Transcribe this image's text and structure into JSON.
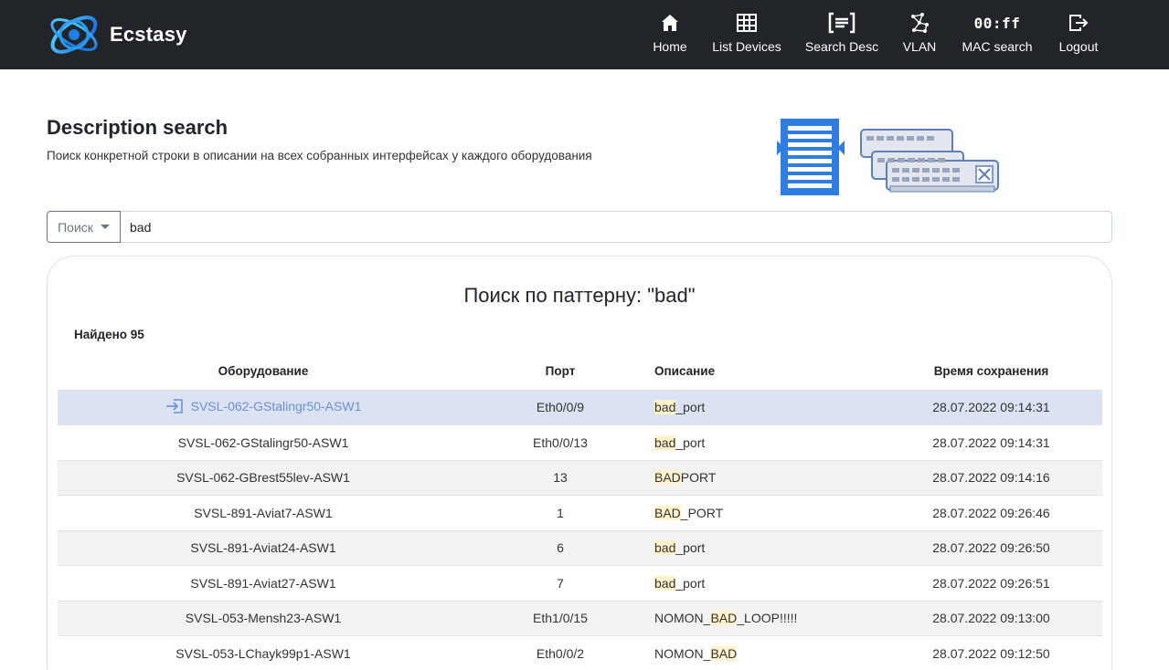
{
  "brand": {
    "name": "Ecstasy"
  },
  "nav": [
    {
      "label": "Home",
      "icon": "home-icon"
    },
    {
      "label": "List Devices",
      "icon": "table-icon"
    },
    {
      "label": "Search Desc",
      "icon": "text-box-icon"
    },
    {
      "label": "VLAN",
      "icon": "network-icon"
    },
    {
      "label": "MAC search",
      "icon": "mac-icon",
      "icon_text": "00:ff"
    },
    {
      "label": "Logout",
      "icon": "logout-icon"
    }
  ],
  "header": {
    "title": "Description search",
    "subtitle": "Поиск конкретной строки в описании на всех собранных интерфейсах у каждого оборудования"
  },
  "search": {
    "select_label": "Поиск",
    "value": "bad"
  },
  "results": {
    "title": "Поиск по паттерну: \"bad\"",
    "found": "Найдено 95",
    "columns": [
      "Оборудование",
      "Порт",
      "Описание",
      "Время сохранения"
    ],
    "rows": [
      {
        "device": "SVSL-062-GStalingr50-ASW1",
        "port": "Eth0/0/9",
        "desc_match": "bad",
        "desc_rest": "_port",
        "desc_prefix": "",
        "time": "28.07.2022 09:14:31"
      },
      {
        "device": "SVSL-062-GStalingr50-ASW1",
        "port": "Eth0/0/13",
        "desc_match": "bad",
        "desc_rest": "_port",
        "desc_prefix": "",
        "time": "28.07.2022 09:14:31"
      },
      {
        "device": "SVSL-062-GBrest55lev-ASW1",
        "port": "13",
        "desc_match": "BAD",
        "desc_rest": "PORT",
        "desc_prefix": "",
        "time": "28.07.2022 09:14:16"
      },
      {
        "device": "SVSL-891-Aviat7-ASW1",
        "port": "1",
        "desc_match": "BAD",
        "desc_rest": "_PORT",
        "desc_prefix": "",
        "time": "28.07.2022 09:26:46"
      },
      {
        "device": "SVSL-891-Aviat24-ASW1",
        "port": "6",
        "desc_match": "bad",
        "desc_rest": "_port",
        "desc_prefix": "",
        "time": "28.07.2022 09:26:50"
      },
      {
        "device": "SVSL-891-Aviat27-ASW1",
        "port": "7",
        "desc_match": "bad",
        "desc_rest": "_port",
        "desc_prefix": "",
        "time": "28.07.2022 09:26:51"
      },
      {
        "device": "SVSL-053-Mensh23-ASW1",
        "port": "Eth1/0/15",
        "desc_prefix": "NOMON_",
        "desc_match": "BAD",
        "desc_rest": "_LOOP!!!!!",
        "time": "28.07.2022 09:13:00"
      },
      {
        "device": "SVSL-053-LChayk99p1-ASW1",
        "port": "Eth0/0/2",
        "desc_prefix": "NOMON_",
        "desc_match": "BAD",
        "desc_rest": "",
        "time": "28.07.2022 09:12:50"
      }
    ]
  },
  "colors": {
    "navbar": "#212529",
    "link": "#6f8fd8",
    "active_row": "#dbe2f1",
    "highlight": "#fff3cd"
  }
}
